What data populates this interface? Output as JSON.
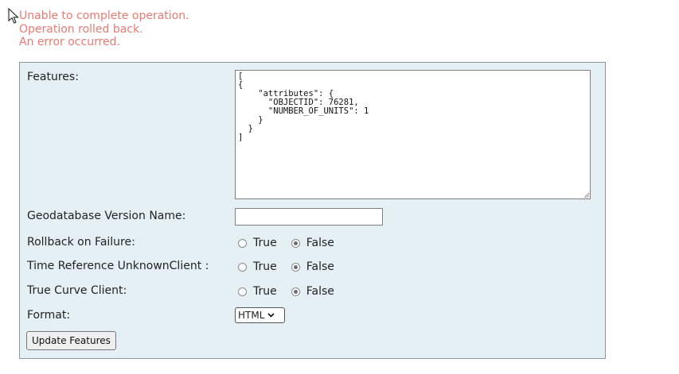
{
  "errors": [
    "Unable to complete operation.",
    "Operation rolled back.",
    "An error occurred."
  ],
  "form": {
    "features_label": "Features:",
    "features_value": "[\n{\n    \"attributes\": {\n      \"OBJECTID\": 76281,\n      \"NUMBER_OF_UNITS\": 1\n    }\n  }\n]",
    "gdb_version_label": "Geodatabase Version Name:",
    "gdb_version_value": "",
    "rollback_label": "Rollback on Failure:",
    "time_ref_label": "Time Reference UnknownClient :",
    "true_curve_label": "True Curve Client:",
    "option_true": "True",
    "option_false": "False",
    "rollback_selected": "False",
    "time_ref_selected": "False",
    "true_curve_selected": "False",
    "format_label": "Format:",
    "format_value": "HTML",
    "submit_label": "Update Features"
  },
  "icons": {
    "cursor": "mouse-pointer-icon",
    "select_chevron": "chevron-down-icon",
    "resize": "resize-grip-icon"
  }
}
